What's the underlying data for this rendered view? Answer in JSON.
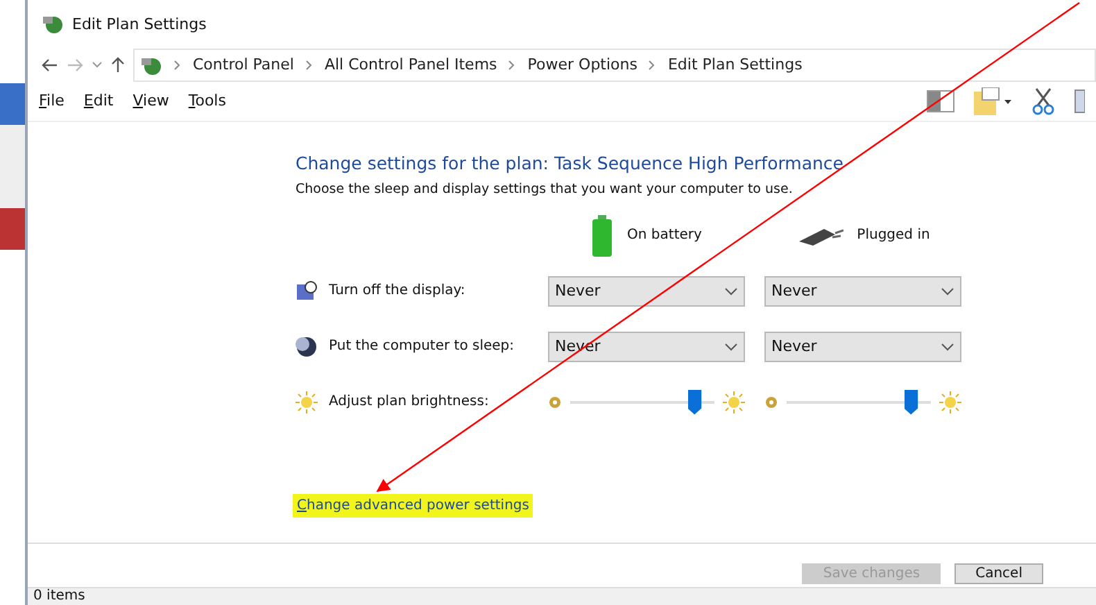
{
  "window": {
    "title": "Edit Plan Settings"
  },
  "breadcrumb": [
    "Control Panel",
    "All Control Panel Items",
    "Power Options",
    "Edit Plan Settings"
  ],
  "menu": [
    "File",
    "Edit",
    "View",
    "Tools"
  ],
  "plan": {
    "heading": "Change settings for the plan: Task Sequence High Performance",
    "description": "Choose the sleep and display settings that you want your computer to use.",
    "columns": [
      {
        "label": "On battery",
        "kind": "battery"
      },
      {
        "label": "Plugged in",
        "kind": "plug"
      }
    ],
    "settings": [
      {
        "label": "Turn off the display:",
        "kind": "dropdown",
        "values": [
          {
            "value": "Never"
          },
          {
            "value": "Never"
          }
        ]
      },
      {
        "label": "Put the computer to sleep:",
        "kind": "dropdown",
        "values": [
          {
            "value": "Never"
          },
          {
            "value": "Never"
          }
        ]
      },
      {
        "label": "Adjust plan brightness:",
        "kind": "slider",
        "values": [
          {
            "level": 0.9
          },
          {
            "level": 0.9
          }
        ]
      }
    ]
  },
  "link": {
    "label": "Change advanced power settings",
    "highlighted": true
  },
  "buttons": [
    {
      "label": "Save changes",
      "disabled": true
    },
    {
      "label": "Cancel",
      "disabled": false
    }
  ],
  "status_bar": {
    "text": "0 items"
  }
}
